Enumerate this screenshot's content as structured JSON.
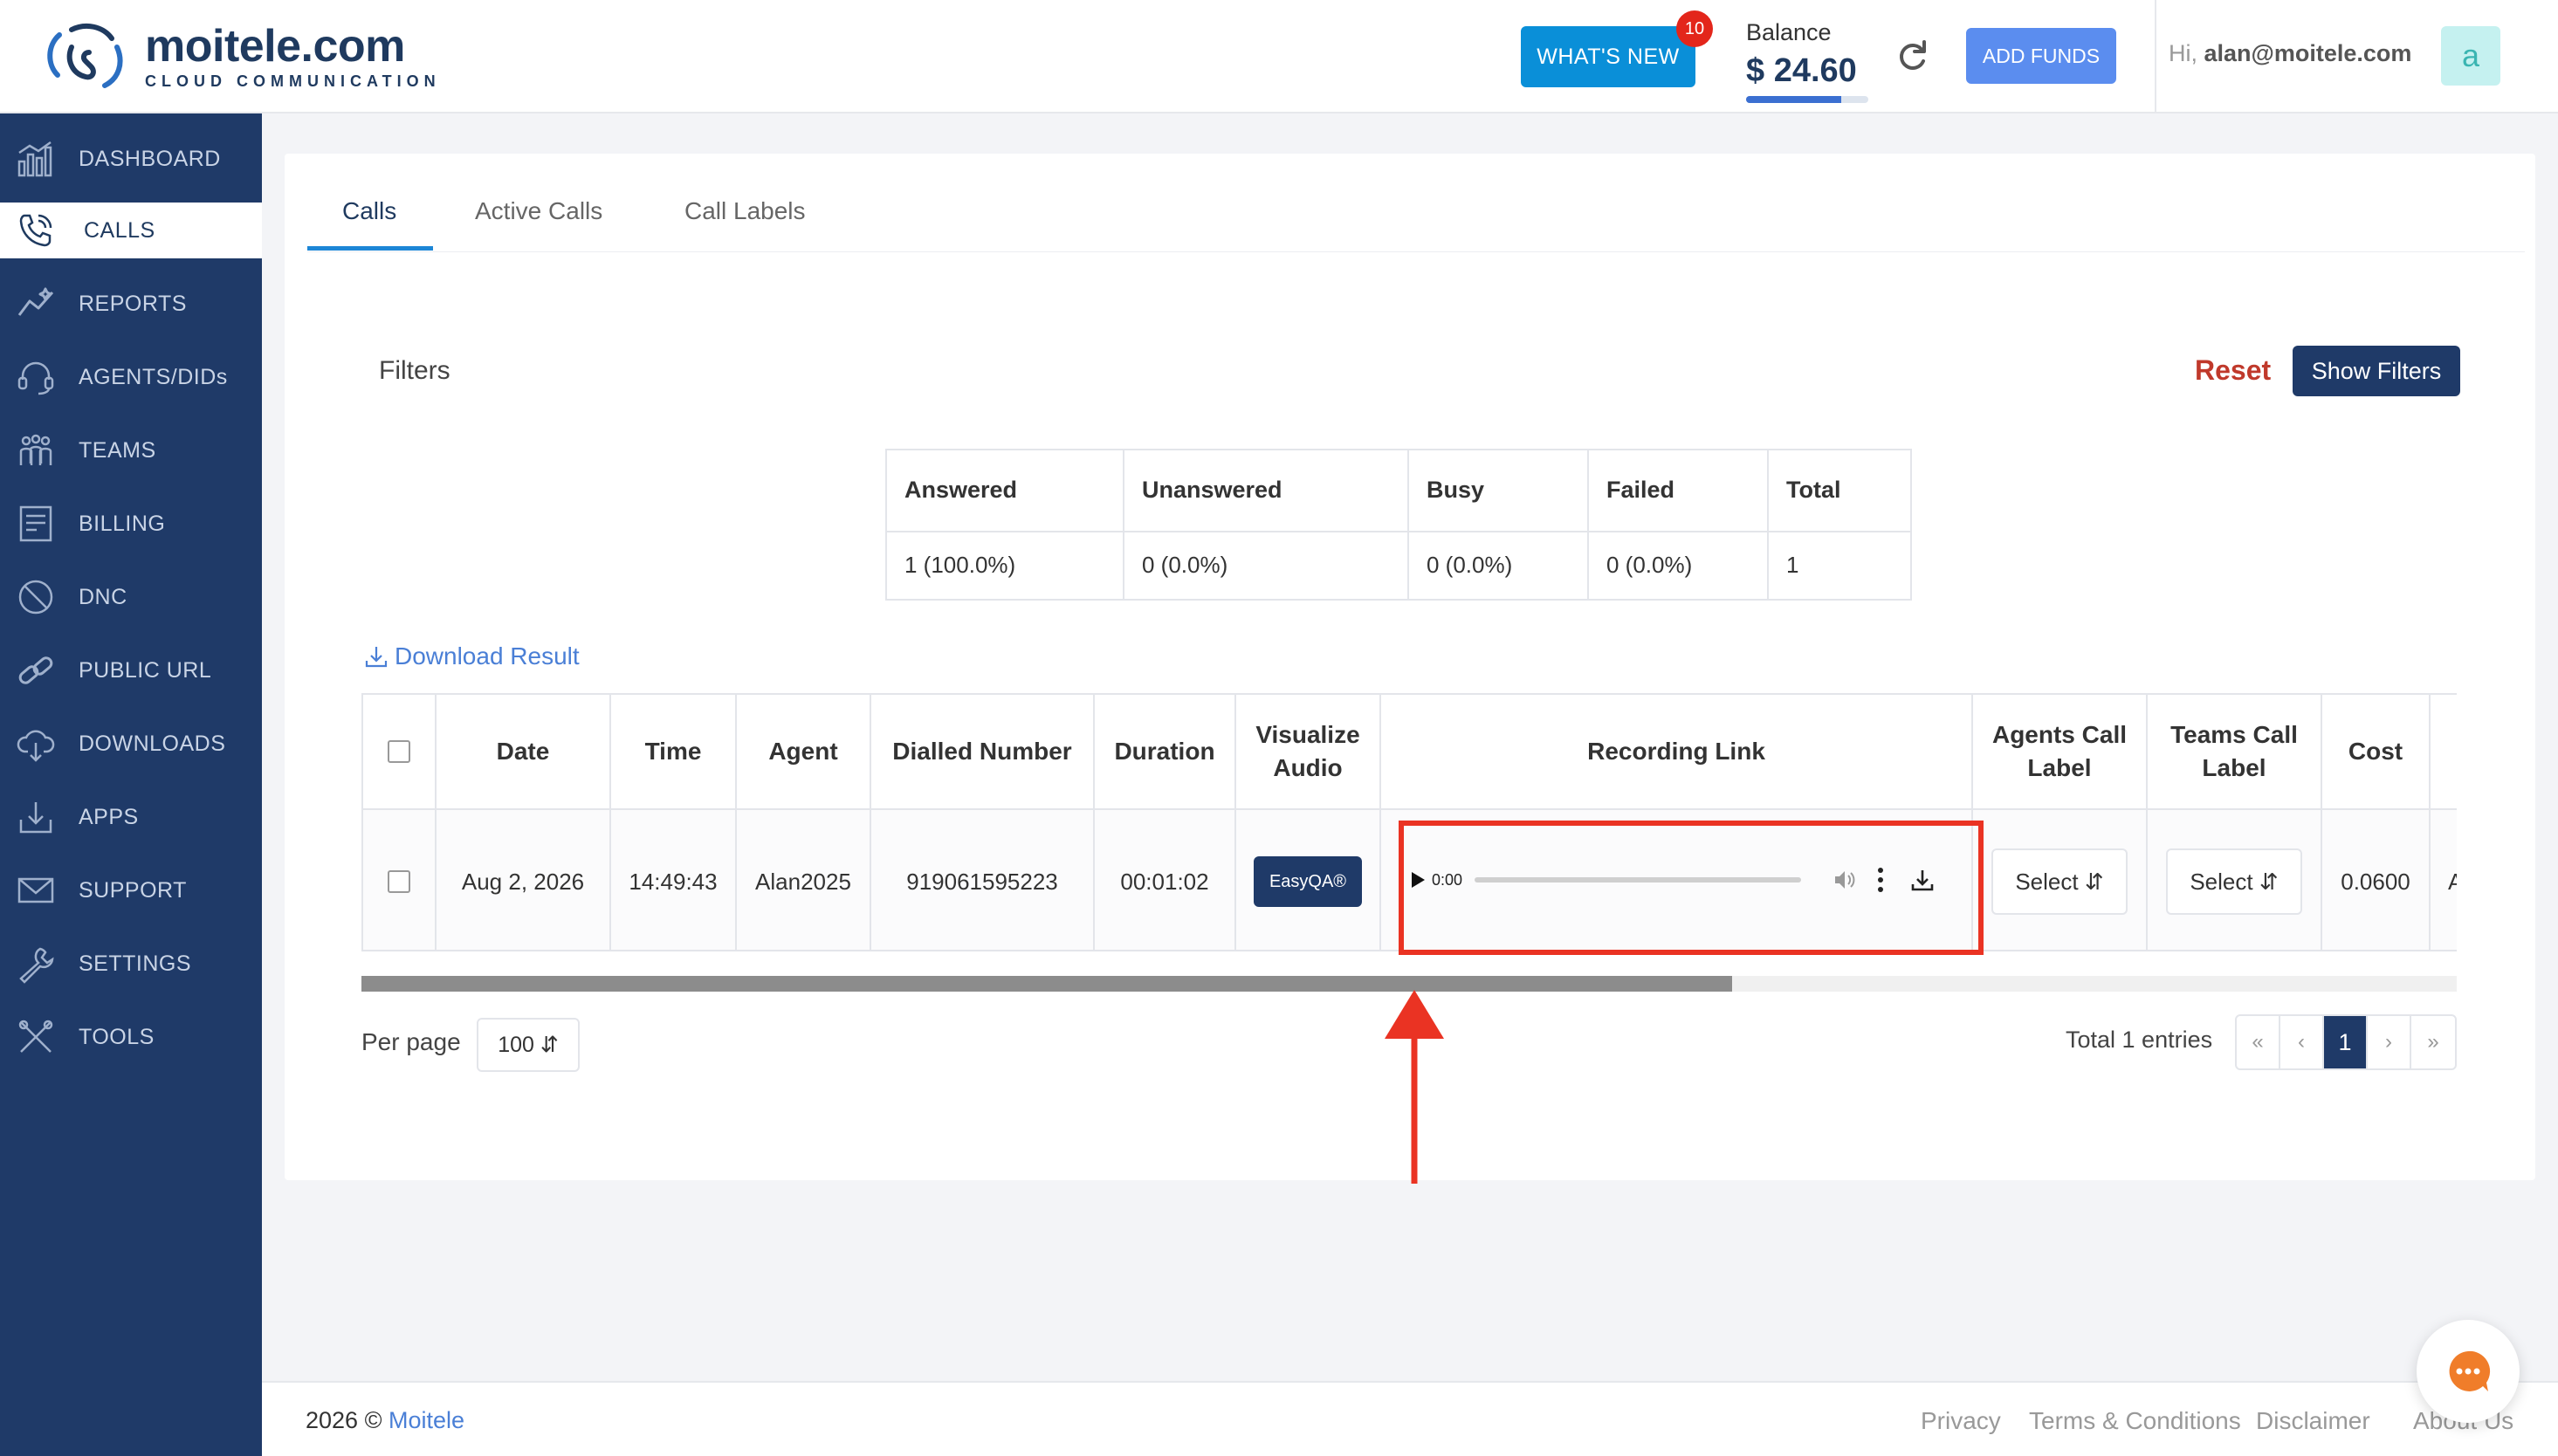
{
  "header": {
    "logo_name": "moitele.com",
    "logo_tag": "CLOUD COMMUNICATION",
    "whats_new_label": "WHAT'S NEW",
    "whats_new_badge": "10",
    "balance_label": "Balance",
    "balance_amount": "$ 24.60",
    "balance_fraction": 0.78,
    "add_funds_label": "ADD FUNDS",
    "greeting_prefix": "Hi,",
    "user_email": "alan@moitele.com",
    "avatar_letter": "a"
  },
  "sidebar": {
    "items": [
      {
        "label": "DASHBOARD",
        "icon": "dashboard-icon"
      },
      {
        "label": "CALLS",
        "icon": "phone-icon",
        "active": true
      },
      {
        "label": "REPORTS",
        "icon": "reports-icon"
      },
      {
        "label": "AGENTS/DIDs",
        "icon": "headset-icon"
      },
      {
        "label": "TEAMS",
        "icon": "teams-icon"
      },
      {
        "label": "BILLING",
        "icon": "billing-icon"
      },
      {
        "label": "DNC",
        "icon": "block-icon"
      },
      {
        "label": "PUBLIC URL",
        "icon": "link-icon"
      },
      {
        "label": "DOWNLOADS",
        "icon": "cloud-download-icon"
      },
      {
        "label": "APPS",
        "icon": "apps-icon"
      },
      {
        "label": "SUPPORT",
        "icon": "mail-icon"
      },
      {
        "label": "SETTINGS",
        "icon": "wrench-icon"
      },
      {
        "label": "TOOLS",
        "icon": "tools-icon"
      }
    ]
  },
  "tabs": [
    {
      "label": "Calls",
      "active": true
    },
    {
      "label": "Active Calls"
    },
    {
      "label": "Call Labels"
    }
  ],
  "filters": {
    "label": "Filters",
    "reset_label": "Reset",
    "show_filters_label": "Show Filters"
  },
  "summary": {
    "headers": [
      "Answered",
      "Unanswered",
      "Busy",
      "Failed",
      "Total"
    ],
    "values": [
      "1 (100.0%)",
      "0 (0.0%)",
      "0 (0.0%)",
      "0 (0.0%)",
      "1"
    ]
  },
  "download_label": "Download Result",
  "table": {
    "headers": {
      "date": "Date",
      "time": "Time",
      "agent": "Agent",
      "dialled": "Dialled Number",
      "duration": "Duration",
      "visualize1": "Visualize",
      "visualize2": "Audio",
      "recording": "Recording Link",
      "agents_label1": "Agents Call",
      "agents_label2": "Label",
      "teams_label1": "Teams Call",
      "teams_label2": "Label",
      "cost": "Cost"
    },
    "row": {
      "date": "Aug 2, 2026",
      "time": "14:49:43",
      "agent": "Alan2025",
      "dialled": "919061595223",
      "duration": "00:01:02",
      "easyqa_label": "EasyQA®",
      "audio_time": "0:00",
      "agents_select": "Select",
      "teams_select": "Select",
      "cost": "0.0600",
      "overflow": "A"
    }
  },
  "pagination": {
    "per_page_label": "Per page",
    "per_page_value": "100",
    "total_label": "Total 1 entries",
    "first": "«",
    "prev": "‹",
    "current": "1",
    "next": "›",
    "last": "»"
  },
  "footer": {
    "year": "2026 ©",
    "brand": "Moitele",
    "links": [
      "Privacy",
      "Terms & Conditions",
      "Disclaimer",
      "About Us"
    ]
  },
  "colors": {
    "sidebar": "#1f3a68",
    "accent": "#0a8fd8",
    "highlight": "#ea3323"
  }
}
